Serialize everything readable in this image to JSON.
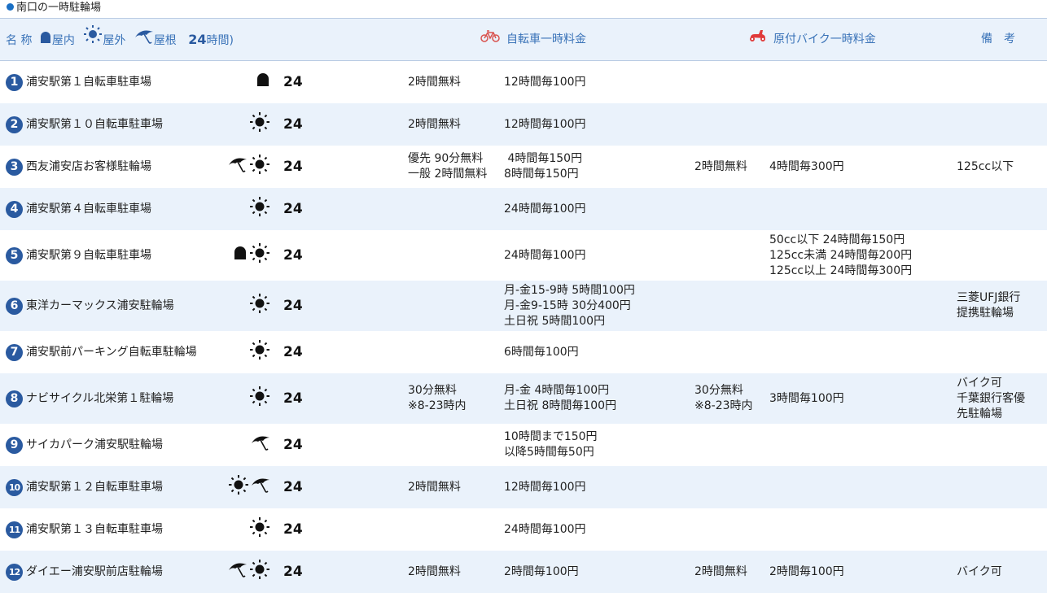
{
  "section_title": "南口の一時駐輪場",
  "header": {
    "name_label": "名 称",
    "indoor_label": "屋内",
    "outdoor_label": "屋外",
    "roof_label": "屋根",
    "h24_label": "24",
    "hours_label": "時間)",
    "bicycle_fee_label": "自転車一時料金",
    "moped_fee_label": "原付バイク一時料金",
    "notes_label": "備　考"
  },
  "rows": [
    {
      "num": "1",
      "name": "浦安駅第１自転車駐車場",
      "icons": [
        "indoor-icon"
      ],
      "h24": "24",
      "bike_free": "2時間無料",
      "bike_fee": "12時間毎100円",
      "moto_free": "",
      "moto_fee": "",
      "note": ""
    },
    {
      "num": "2",
      "name": "浦安駅第１０自転車駐車場",
      "icons": [
        "sun-icon"
      ],
      "h24": "24",
      "bike_free": "2時間無料",
      "bike_fee": "12時間毎100円",
      "moto_free": "",
      "moto_fee": "",
      "note": ""
    },
    {
      "num": "3",
      "name": "西友浦安店お客様駐輪場",
      "icons": [
        "umbrella-icon",
        "sun-icon"
      ],
      "h24": "24",
      "bike_free": "優先 90分無料\n一般 2時間無料",
      "bike_fee": " 4時間毎150円\n8時間毎150円",
      "moto_free": "2時間無料",
      "moto_fee": "4時間毎300円",
      "note": "125cc以下"
    },
    {
      "num": "4",
      "name": "浦安駅第４自転車駐車場",
      "icons": [
        "sun-icon"
      ],
      "h24": "24",
      "bike_free": "",
      "bike_fee": "24時間毎100円",
      "moto_free": "",
      "moto_fee": "",
      "note": ""
    },
    {
      "num": "5",
      "name": "浦安駅第９自転車駐車場",
      "icons": [
        "indoor-icon",
        "sun-icon"
      ],
      "h24": "24",
      "bike_free": "",
      "bike_fee": "24時間毎100円",
      "moto_free": "",
      "moto_fee": "50cc以下 24時間毎150円\n125cc未満 24時間毎200円\n125cc以上 24時間毎300円",
      "note": ""
    },
    {
      "num": "6",
      "name": "東洋カーマックス浦安駐輪場",
      "icons": [
        "sun-icon"
      ],
      "h24": "24",
      "bike_free": "",
      "bike_fee": "月-金15-9時 5時間100円\n月-金9-15時 30分400円\n土日祝 5時間100円",
      "moto_free": "",
      "moto_fee": "",
      "note": "三菱UFJ銀行\n提携駐輪場"
    },
    {
      "num": "7",
      "name": "浦安駅前パーキング自転車駐輪場",
      "icons": [
        "sun-icon"
      ],
      "h24": "24",
      "bike_free": "",
      "bike_fee": "6時間毎100円",
      "moto_free": "",
      "moto_fee": "",
      "note": ""
    },
    {
      "num": "8",
      "name": "ナビサイクル北栄第１駐輪場",
      "icons": [
        "sun-icon"
      ],
      "h24": "24",
      "bike_free": "30分無料\n※8-23時内",
      "bike_fee": "月-金 4時間毎100円\n土日祝 8時間毎100円",
      "moto_free": "30分無料\n※8-23時内",
      "moto_fee": "3時間毎100円",
      "note": "バイク可\n千葉銀行客優\n先駐輪場"
    },
    {
      "num": "9",
      "name": "サイカパーク浦安駅駐輪場",
      "icons": [
        "umbrella-icon"
      ],
      "h24": "24",
      "bike_free": "",
      "bike_fee": "10時間まで150円\n以降5時間毎50円",
      "moto_free": "",
      "moto_fee": "",
      "note": ""
    },
    {
      "num": "10",
      "name": "浦安駅第１２自転車駐車場",
      "icons": [
        "sun-icon",
        "umbrella-icon"
      ],
      "h24": "24",
      "bike_free": "2時間無料",
      "bike_fee": "12時間毎100円",
      "moto_free": "",
      "moto_fee": "",
      "note": ""
    },
    {
      "num": "11",
      "name": "浦安駅第１３自転車駐車場",
      "icons": [
        "sun-icon"
      ],
      "h24": "24",
      "bike_free": "",
      "bike_fee": "24時間毎100円",
      "moto_free": "",
      "moto_fee": "",
      "note": ""
    },
    {
      "num": "12",
      "name": "ダイエー浦安駅前店駐輪場",
      "icons": [
        "umbrella-icon",
        "sun-icon"
      ],
      "h24": "24",
      "bike_free": "2時間無料",
      "bike_fee": "2時間毎100円",
      "moto_free": "2時間無料",
      "moto_fee": "2時間毎100円",
      "note": "バイク可"
    }
  ],
  "colors": {
    "accent": "#2a5aa0",
    "header_bg": "#eaf2fb",
    "moped_red": "#e03a3a",
    "bike_red": "#d9534f"
  }
}
